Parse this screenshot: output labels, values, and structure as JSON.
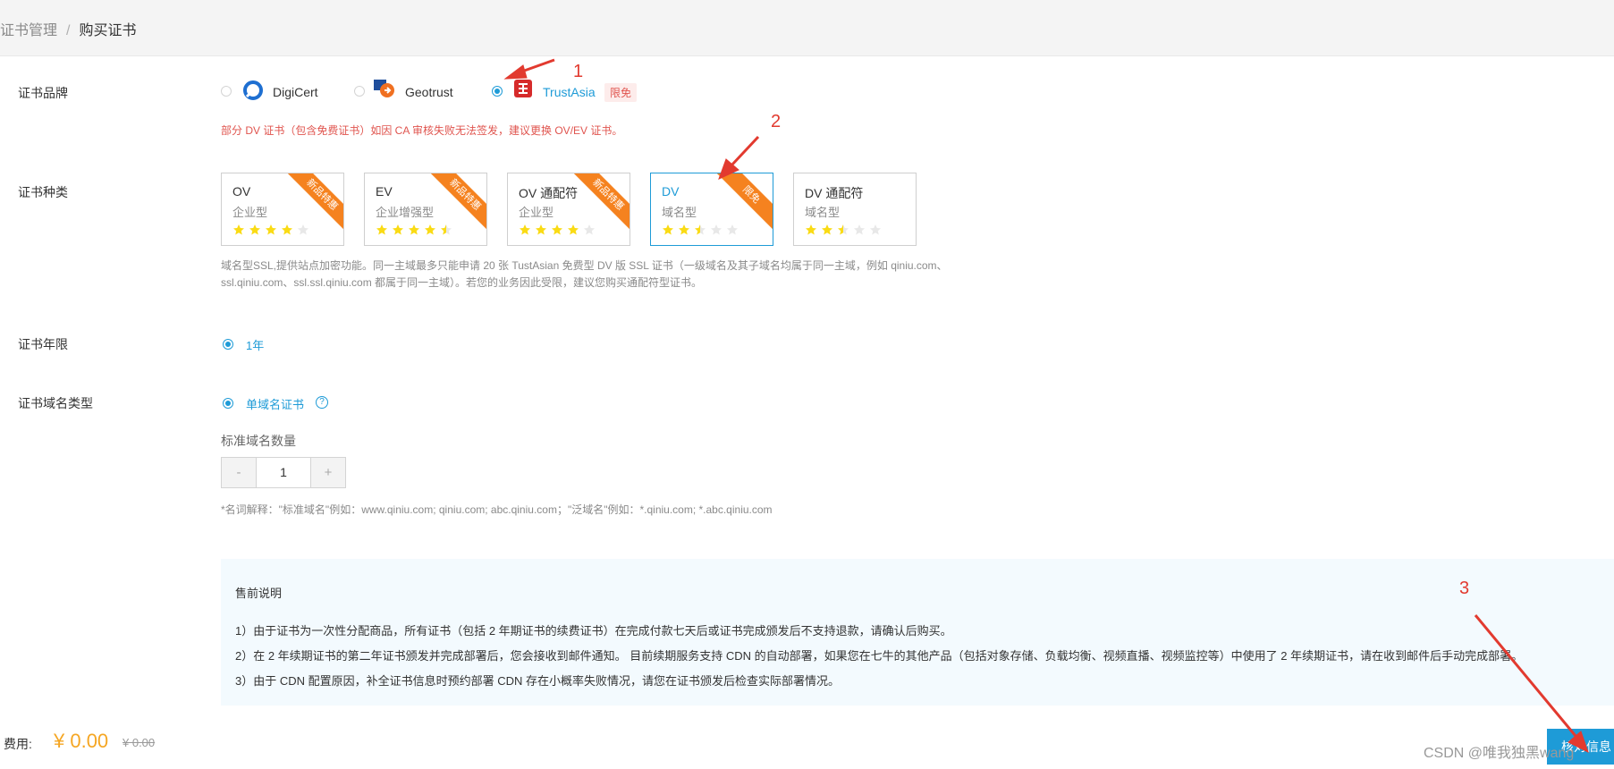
{
  "breadcrumb": {
    "parent": "证书管理",
    "separator": "/",
    "current": "购买证书"
  },
  "brand": {
    "label": "证书品牌",
    "options": [
      {
        "name": "DigiCert",
        "selected": false
      },
      {
        "name": "Geotrust",
        "selected": false
      },
      {
        "name": "TrustAsia",
        "selected": true,
        "tag": "限免"
      }
    ],
    "warning": "部分 DV 证书（包含免费证书）如因 CA 审核失败无法签发，建议更换 OV/EV 证书。"
  },
  "cert_type": {
    "label": "证书种类",
    "cards": [
      {
        "title": "OV",
        "subtitle": "企业型",
        "rating": 4,
        "ribbon": "新品特惠",
        "selected": false
      },
      {
        "title": "EV",
        "subtitle": "企业增强型",
        "rating": 4.5,
        "ribbon": "新品特惠",
        "selected": false
      },
      {
        "title": "OV 通配符",
        "subtitle": "企业型",
        "rating": 4,
        "ribbon": "新品特惠",
        "selected": false
      },
      {
        "title": "DV",
        "subtitle": "域名型",
        "rating": 2.5,
        "ribbon": "限免",
        "selected": true
      },
      {
        "title": "DV 通配符",
        "subtitle": "域名型",
        "rating": 2.5,
        "ribbon": "",
        "selected": false
      }
    ],
    "description_line1": "域名型SSL,提供站点加密功能。同一主域最多只能申请 20 张 TustAsian 免费型 DV 版 SSL 证书（一级域名及其子域名均属于同一主域，例如 qiniu.com、",
    "description_line2": "ssl.qiniu.com、ssl.ssl.qiniu.com 都属于同一主域）。若您的业务因此受限，建议您购买通配符型证书。"
  },
  "period": {
    "label": "证书年限",
    "option": "1年"
  },
  "domain_type": {
    "label": "证书域名类型",
    "option": "单域名证书",
    "help": "?",
    "std_count_label": "标准域名数量",
    "minus": "-",
    "value": "1",
    "plus": "+",
    "note": "*名词解释：\"标准域名\"例如：www.qiniu.com; qiniu.com; abc.qiniu.com；\"泛域名\"例如：*.qiniu.com; *.abc.qiniu.com"
  },
  "presale": {
    "title": "售前说明",
    "lines": [
      "1）由于证书为一次性分配商品，所有证书（包括 2 年期证书的续费证书）在完成付款七天后或证书完成颁发后不支持退款，请确认后购买。",
      "2）在 2 年续期证书的第二年证书颁发并完成部署后，您会接收到邮件通知。 目前续期服务支持 CDN 的自动部署，如果您在七牛的其他产品（包括对象存储、负载均衡、视频直播、视频监控等）中使用了 2 年续期证书，请在收到邮件后手动完成部署。",
      "3）由于 CDN 配置原因，补全证书信息时预约部署 CDN 存在小概率失败情况，请您在证书颁发后检查实际部署情况。"
    ]
  },
  "footer": {
    "fee_label": "费用:",
    "fee_value": "¥ 0.00",
    "fee_original": "¥ 0.00",
    "confirm_label": "核对信息",
    "watermark": "CSDN @唯我独黑wang"
  },
  "annotations": [
    "1",
    "2",
    "3"
  ],
  "colors": {
    "accent": "#1e9bd7",
    "warning": "#e0554f",
    "ribbon": "#f5821f",
    "star": "#fadb14",
    "annotation": "#e23a2f"
  }
}
